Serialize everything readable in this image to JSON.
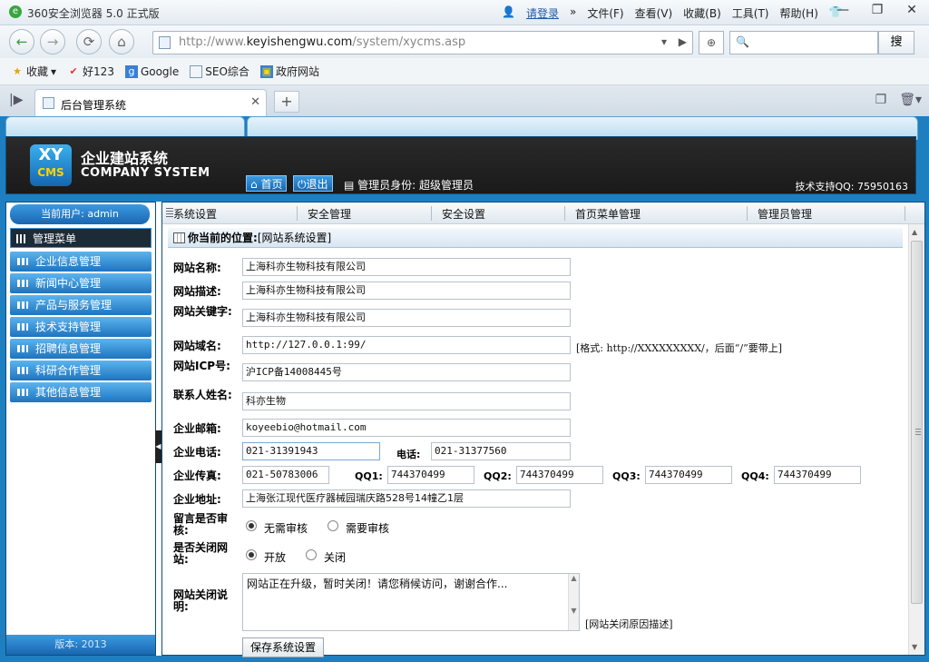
{
  "browser": {
    "app_title": "360安全浏览器 5.0 正式版",
    "login": "请登录",
    "menus": [
      "文件(F)",
      "查看(V)",
      "收藏(B)",
      "工具(T)",
      "帮助(H)"
    ],
    "url_prefix": "http://www.",
    "url_host": "keyishengwu.com",
    "url_path": "/system/xycms.asp",
    "search_button": "搜",
    "favorites": [
      "收藏",
      "好123",
      "Google",
      "SEO综合",
      "政府网站"
    ],
    "tab_title": "后台管理系统"
  },
  "header": {
    "logo_top": "XY",
    "logo_bottom": "CMS",
    "brand_name": "企业建站系统",
    "brand_en": "COMPANY SYSTEM",
    "home_button": "首页",
    "logout_button": "退出",
    "admin_role": "管理员身份: 超级管理员",
    "support": "技术支持QQ: 75950163"
  },
  "sidebar": {
    "current_user": "当前用户: admin",
    "menu_title": "管理菜单",
    "items": [
      "企业信息管理",
      "新闻中心管理",
      "产品与服务管理",
      "技术支持管理",
      "招聘信息管理",
      "科研合作管理",
      "其他信息管理"
    ],
    "version": "版本: 2013"
  },
  "subnav": [
    "系统设置",
    "安全管理",
    "安全设置",
    "首页菜单管理",
    "管理员管理"
  ],
  "location": {
    "label": "你当前的位置:",
    "value": "[网站系统设置]"
  },
  "form": {
    "site_name_label": "网站名称:",
    "site_name": "上海科亦生物科技有限公司",
    "site_desc_label": "网站描述:",
    "site_desc": "上海科亦生物科技有限公司",
    "site_kw_label": "网站关键字:",
    "site_kw": "上海科亦生物科技有限公司",
    "domain_label": "网站域名:",
    "domain": "http://127.0.0.1:99/",
    "domain_hint": "[格式: http://XXXXXXXXX/，后面“/”要带上]",
    "icp_label": "网站ICP号:",
    "icp": "沪ICP备14008445号",
    "contact_label": "联系人姓名:",
    "contact": "科亦生物",
    "email_label": "企业邮箱:",
    "email": "koyeebio@hotmail.com",
    "phone_label": "企业电话:",
    "phone": "021-31391943",
    "tel_label": "电话:",
    "tel": "021-31377560",
    "fax_label": "企业传真:",
    "fax": "021-50783006",
    "qq1_label": "QQ1:",
    "qq1": "744370499",
    "qq2_label": "QQ2:",
    "qq2": "744370499",
    "qq3_label": "QQ3:",
    "qq3": "744370499",
    "qq4_label": "QQ4:",
    "qq4": "744370499",
    "address_label": "企业地址:",
    "address": "上海张江现代医疗器械园瑞庆路528号14幢乙1层",
    "review_label": "留言是否审核:",
    "review_opt1": "无需审核",
    "review_opt2": "需要审核",
    "close_label": "是否关闭网站:",
    "close_opt1": "开放",
    "close_opt2": "关闭",
    "close_desc_label": "网站关闭说明:",
    "close_desc": "网站正在升级，暂时关闭！请您稍候访问，谢谢合作...",
    "close_desc_hint": "[网站关闭原因描述]",
    "save_button": "保存系统设置"
  }
}
